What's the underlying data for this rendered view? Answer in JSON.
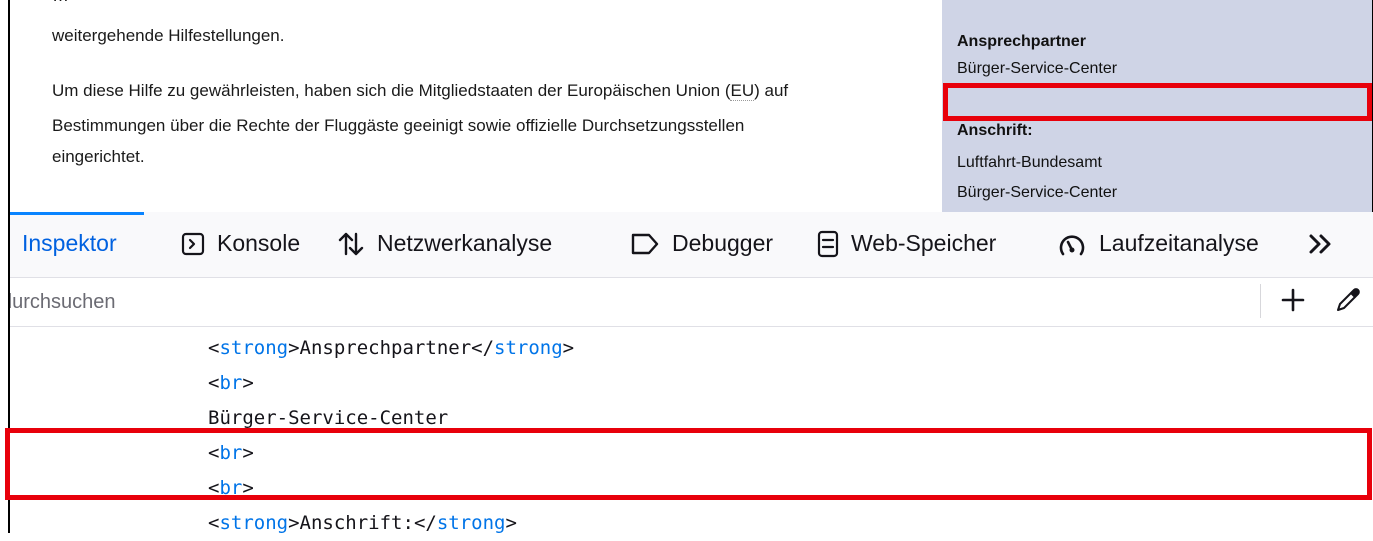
{
  "webpage": {
    "article_lines": [
      "weitergehende Hilfestellungen.",
      "Um diese Hilfe zu gewährleisten, haben sich die Mitgliedstaaten der Europäischen Union (",
      "EU",
      ") auf",
      "Bestimmungen über die Rechte der Fluggäste geeinigt sowie offizielle Durchsetzungsstellen",
      "eingerichtet."
    ],
    "sidebar": {
      "heading": "Ansprechpartner",
      "contact": "Bürger-Service-Center",
      "address_heading": "Anschrift:",
      "address_line1": "Luftfahrt-Bundesamt",
      "address_line2": "Bürger-Service-Center"
    }
  },
  "devtools": {
    "tabs": [
      {
        "label": "Inspektor",
        "icon": "inspector",
        "selected": true
      },
      {
        "label": "Konsole",
        "icon": "console-icon"
      },
      {
        "label": "Netzwerkanalyse",
        "icon": "network-arrows-icon"
      },
      {
        "label": "Debugger",
        "icon": "debugger-tag-icon"
      },
      {
        "label": "Web-Speicher",
        "icon": "storage-icon"
      },
      {
        "label": "Laufzeitanalyse",
        "icon": "gauge-icon"
      }
    ],
    "overflow_icon": "double-chevron-icon",
    "search": {
      "placeholder": "durchsuchen",
      "add_icon": "plus-icon",
      "picker_icon": "eyedropper-icon"
    },
    "markup_rows": [
      {
        "open": "strong",
        "text": "Ansprechpartner",
        "close": "strong"
      },
      {
        "open": "br"
      },
      {
        "text": "Bürger-Service-Center"
      },
      {
        "open": "br"
      },
      {
        "open": "br"
      },
      {
        "open": "strong",
        "text": "Anschrift:",
        "close": "strong"
      }
    ]
  },
  "colors": {
    "highlight": "#e8000b",
    "tag": "#0074e8",
    "sidebar_bg": "#cfd4e6",
    "selected_tab": "#0061e0"
  }
}
